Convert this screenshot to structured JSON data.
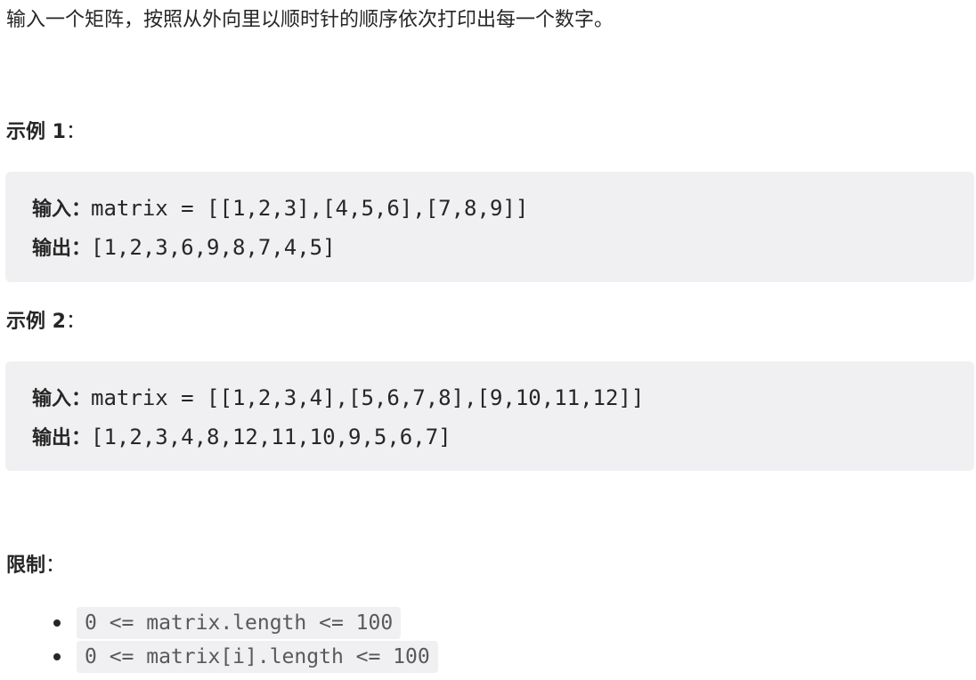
{
  "description": "输入一个矩阵，按照从外向里以顺时针的顺序依次打印出每一个数字。",
  "examples": [
    {
      "title": "示例 1",
      "input_label": "输入：",
      "input": "matrix = [[1,2,3],[4,5,6],[7,8,9]]",
      "output_label": "输出：",
      "output": "[1,2,3,6,9,8,7,4,5]"
    },
    {
      "title": "示例 2",
      "input_label": "输入：",
      "input": "matrix = [[1,2,3,4],[5,6,7,8],[9,10,11,12]]",
      "output_label": "输出：",
      "output": "[1,2,3,4,8,12,11,10,9,5,6,7]"
    }
  ],
  "colon": "：",
  "limits": {
    "title": "限制",
    "items": [
      "0 <= matrix.length <= 100",
      "0 <= matrix[i].length <= 100"
    ]
  },
  "colors": {
    "text": "#262626",
    "code_background": "#f0f0f2",
    "inline_code_text": "#595959"
  }
}
